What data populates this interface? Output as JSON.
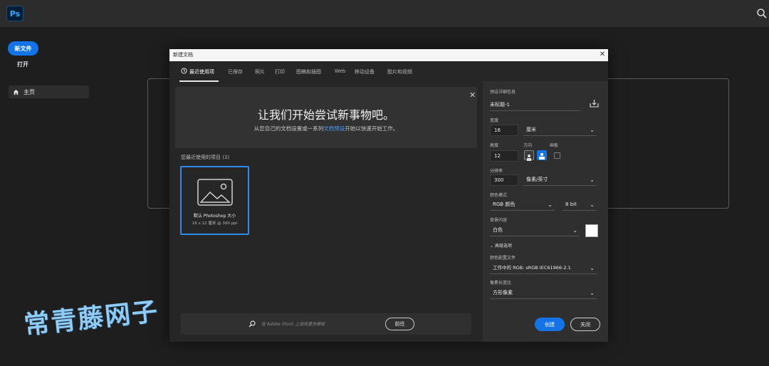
{
  "app": {
    "logo": "Ps",
    "search_icon": "search-icon"
  },
  "home": {
    "new_file": "新文件",
    "open": "打开",
    "nav_home": "主页"
  },
  "dialog": {
    "title": "新建文档",
    "tabs": [
      "最近使用项",
      "已保存",
      "照片",
      "打印",
      "图稿和插图",
      "Web",
      "移动设备",
      "胶片和视频"
    ],
    "active_tab": "最近使用项",
    "welcome": {
      "title": "让我们开始尝试新事物吧。",
      "subtitle_before": "从您自己的文档设置或一系列",
      "subtitle_link": "文档预设",
      "subtitle_after": "开始以快速开始工作。"
    },
    "recent_label": "您最近使用的项目 (1)",
    "preset": {
      "name": "默认 Photoshop 大小",
      "size": "16 x 12 厘米 @ 300 ppi"
    },
    "search": {
      "placeholder": "在 Adobe Stock 上查找更多模板",
      "go_label": "前往"
    },
    "details": {
      "preset_details_label": "预设详细信息",
      "doc_name": "未标题-1",
      "width_label": "宽度",
      "width_value": "16",
      "width_unit": "厘米",
      "height_label": "高度",
      "height_value": "12",
      "orientation_label": "方向",
      "artboard_label": "画板",
      "resolution_label": "分辨率",
      "resolution_value": "300",
      "resolution_unit": "像素/英寸",
      "color_mode_label": "颜色模式",
      "color_mode": "RGB 颜色",
      "bit_depth": "8 bit",
      "bg_label": "背景内容",
      "bg_value": "白色",
      "bg_color": "#ffffff",
      "advanced_label": "高级选项",
      "profile_label": "颜色配置文件",
      "profile_value": "工作中的 RGB: sRGB IEC61966-2.1",
      "pixel_aspect_label": "像素长宽比",
      "pixel_aspect_value": "方形像素"
    },
    "create_label": "创建",
    "close_label": "关闭"
  },
  "watermark": "常青藤网子"
}
